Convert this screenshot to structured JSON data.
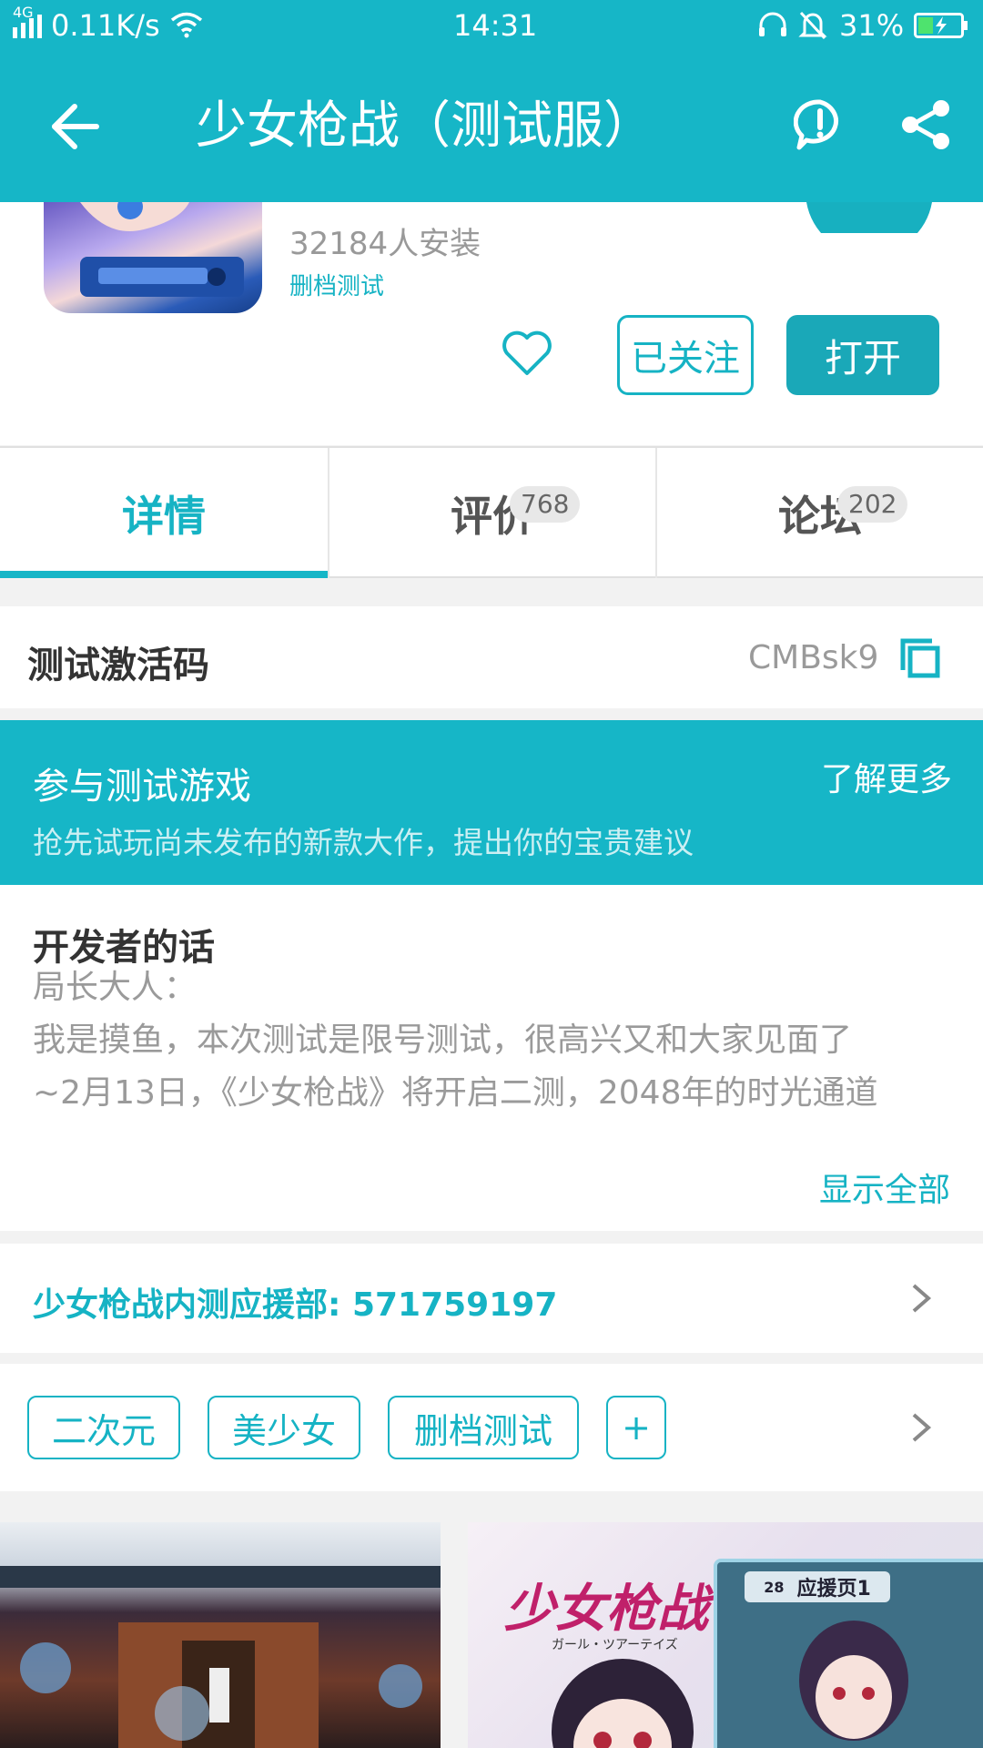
{
  "status_bar": {
    "network": "4G",
    "speed": "0.11K/s",
    "time": "14:31",
    "battery": "31%"
  },
  "app_bar": {
    "title": "少女枪战（测试服）"
  },
  "header": {
    "install_count": "32184人安装",
    "status_tag": "删档测试",
    "follow_label": "已关注",
    "open_label": "打开"
  },
  "tabs": [
    {
      "label": "详情",
      "badge": ""
    },
    {
      "label": "评价",
      "badge": "768"
    },
    {
      "label": "论坛",
      "badge": "202"
    }
  ],
  "activation": {
    "label": "测试激活码",
    "code": "CMBsk9"
  },
  "test_banner": {
    "title": "参与测试游戏",
    "more": "了解更多",
    "subtitle": "抢先试玩尚未发布的新款大作，提出你的宝贵建议"
  },
  "developer": {
    "title": "开发者的话",
    "lines": [
      "局长大人：",
      "我是摸鱼，本次测试是限号测试，很高兴又和大家见面了",
      "~2月13日，《少女枪战》将开启二测，2048年的时光通道"
    ],
    "show_all": "显示全部"
  },
  "group": {
    "label": "少女枪战内测应援部: ",
    "number": "571759197"
  },
  "tags": [
    "二次元",
    "美少女",
    "删档测试",
    "+"
  ],
  "screenshots": {
    "logo_text": "少女枪战",
    "logo_sub": "ガール・ツアーテイズ",
    "panel_title": "应援页1",
    "panel_num": "28"
  },
  "colors": {
    "accent": "#16b6c7",
    "button": "#1aa8b8"
  }
}
